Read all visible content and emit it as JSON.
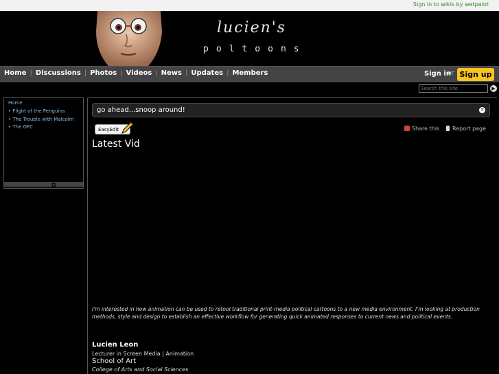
{
  "topbar": {
    "signin_link": "Sign in to wikis by wetpaint"
  },
  "header": {
    "title_line1": "lucien's",
    "title_line2": "poltoons"
  },
  "nav": {
    "items": [
      "Home",
      "Discussions",
      "Photos",
      "Videos",
      "News",
      "Updates",
      "Members"
    ],
    "sign_in": "Sign in",
    "or": "or",
    "sign_up": "Sign up"
  },
  "search": {
    "placeholder": "Search this site",
    "go_icon": "arrow-right-icon"
  },
  "sidebar": {
    "home": "Home",
    "items": [
      "Flight of the Penguins",
      "The Trouble with Malcolm",
      "The GFC"
    ]
  },
  "main": {
    "announcement": "go ahead...snoop around!",
    "easyedit_label": "EasyEdit",
    "share_label": "Share this",
    "report_label": "Report page",
    "page_title": "Latest Vid",
    "bio": "I'm interested in how animation can be used to retool traditional print-media political cartoons to a new media environment. I'm looking at production methods, style and design to establish an effective workflow for generating quick animated responses to current news and political events.",
    "author_name": "Lucien Leon",
    "author_role": "Lecturer in Screen Media | Animation",
    "author_school": "School of Art",
    "author_college": "College of Arts and Social Sciences"
  },
  "colors": {
    "accent_signup": "#f7c520",
    "link_blue": "#8ab8d8",
    "top_link_green": "#2e8b1f"
  }
}
